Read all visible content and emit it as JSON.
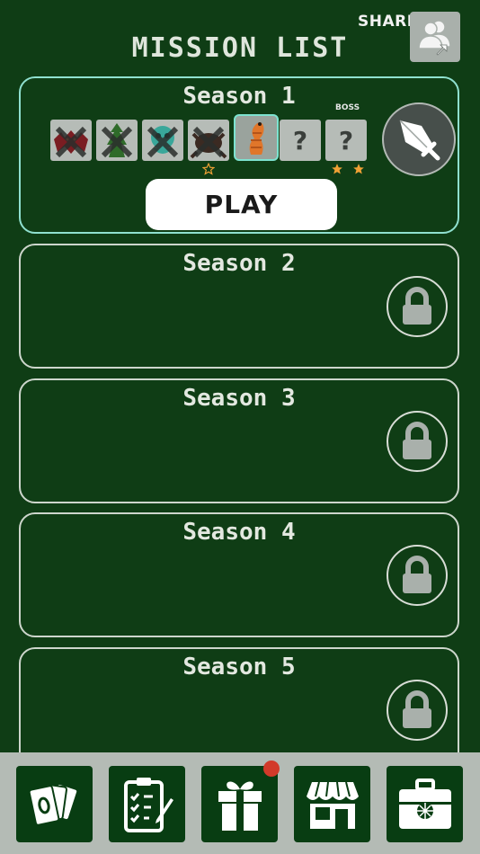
{
  "share": {
    "label": "SHARE",
    "icon": "share-users-icon"
  },
  "title": "MISSION LIST",
  "seasons": [
    {
      "title": "Season 1",
      "locked": false
    },
    {
      "title": "Season 2",
      "locked": true
    },
    {
      "title": "Season 3",
      "locked": true
    },
    {
      "title": "Season 4",
      "locked": true
    },
    {
      "title": "Season 5",
      "locked": true
    }
  ],
  "season1": {
    "missions": [
      {
        "icon": "red-bat-monster-icon",
        "status": "defeated"
      },
      {
        "icon": "green-goblin-monster-icon",
        "status": "defeated"
      },
      {
        "icon": "teal-slime-monster-icon",
        "status": "defeated"
      },
      {
        "icon": "dark-crab-monster-icon",
        "status": "defeated",
        "stars": 1,
        "star_style": "outline"
      },
      {
        "icon": "orange-worm-monster-icon",
        "status": "current"
      },
      {
        "icon": "unknown-mission",
        "label": "?",
        "status": "locked"
      },
      {
        "icon": "unknown-mission",
        "label": "?",
        "status": "locked",
        "boss": true,
        "stars": 2,
        "star_style": "filled"
      }
    ],
    "boss_label": "BOSS",
    "play_label": "PLAY",
    "sword_icon": "sword-icon"
  },
  "lock_icon": "lock-icon",
  "bottom_bar": [
    {
      "name": "cards",
      "icon": "cards-icon"
    },
    {
      "name": "missions",
      "icon": "clipboard-checklist-icon"
    },
    {
      "name": "gift",
      "icon": "gift-icon",
      "notification": true
    },
    {
      "name": "shop",
      "icon": "shop-icon"
    },
    {
      "name": "chest",
      "icon": "treasure-chest-icon"
    }
  ],
  "colors": {
    "background": "#0f3d15",
    "active_border": "#8fe0cf",
    "star": "#f0a135",
    "badge": "#d23a2a",
    "bottom_bar": "#b4bbb5",
    "tab": "#083d12"
  }
}
